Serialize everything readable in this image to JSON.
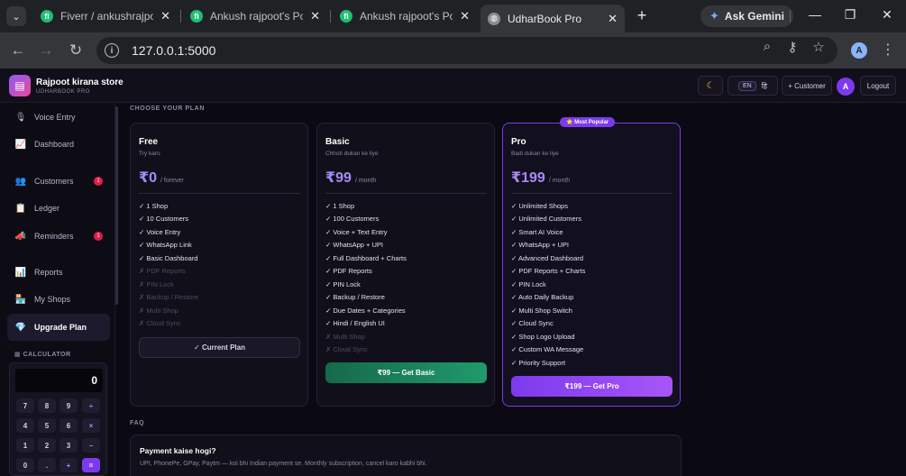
{
  "browser": {
    "tabs": [
      {
        "title": "Fiverr / ankushrajpoo29",
        "favicon": "fiverr-icon"
      },
      {
        "title": "Ankush rajpoot's Portfolio",
        "favicon": "fiverr-icon"
      },
      {
        "title": "Ankush rajpoot's Portfolio",
        "favicon": "fiverr-icon"
      },
      {
        "title": "UdharBook Pro",
        "favicon": "globe-icon"
      }
    ],
    "gemini_label": "Ask Gemini",
    "url": "127.0.0.1:5000",
    "profile_initial": "A"
  },
  "app": {
    "store_name": "Rajpoot kirana store",
    "brand": "UDHARBOOK PRO",
    "header": {
      "lang_en": "EN",
      "lang_hi": "हि",
      "add_customer": "+ Customer",
      "avatar": "A",
      "logout": "Logout"
    }
  },
  "sidebar": {
    "items": [
      {
        "label": "Voice Entry",
        "icon": "mic-icon"
      },
      {
        "label": "Dashboard",
        "icon": "chart-icon"
      },
      {
        "label": "Customers",
        "icon": "users-icon",
        "badge": "1"
      },
      {
        "label": "Ledger",
        "icon": "clipboard-icon"
      },
      {
        "label": "Reminders",
        "icon": "bell-icon",
        "badge": "1"
      },
      {
        "label": "Reports",
        "icon": "bar-chart-icon"
      },
      {
        "label": "My Shops",
        "icon": "store-icon"
      },
      {
        "label": "Upgrade Plan",
        "icon": "gem-icon"
      }
    ],
    "calculator": {
      "title": "CALCULATOR",
      "display": "0",
      "keys": [
        [
          "7",
          "8",
          "9",
          "÷"
        ],
        [
          "4",
          "5",
          "6",
          "×"
        ],
        [
          "1",
          "2",
          "3",
          "−"
        ],
        [
          "0",
          ".",
          "+",
          "="
        ]
      ]
    }
  },
  "plans": {
    "section_title": "CHOOSE YOUR PLAN",
    "popular_badge": "⭐ Most Popular",
    "cards": [
      {
        "name": "Free",
        "subtitle": "Try karo",
        "price": "₹0",
        "period": "/ forever",
        "features": [
          "✓ 1 Shop",
          "✓ 10 Customers",
          "✓ Voice Entry",
          "✓ WhatsApp Link",
          "✓ Basic Dashboard"
        ],
        "disabled": [
          "✗ PDF Reports",
          "✗ PIN Lock",
          "✗ Backup / Restore",
          "✗ Multi Shop",
          "✗ Cloud Sync"
        ],
        "button": "✓ Current Plan"
      },
      {
        "name": "Basic",
        "subtitle": "Chhoti dukan ke liye",
        "price": "₹99",
        "period": "/ month",
        "features": [
          "✓ 1 Shop",
          "✓ 100 Customers",
          "✓ Voice + Text Entry",
          "✓ WhatsApp + UPI",
          "✓ Full Dashboard + Charts",
          "✓ PDF Reports",
          "✓ PIN Lock",
          "✓ Backup / Restore",
          "✓ Due Dates + Categories",
          "✓ Hindi / English UI"
        ],
        "disabled": [
          "✗ Multi Shop",
          "✗ Cloud Sync"
        ],
        "button": "₹99 — Get Basic"
      },
      {
        "name": "Pro",
        "subtitle": "Badi dukan ke liye",
        "price": "₹199",
        "period": "/ month",
        "features": [
          "✓ Unlimited Shops",
          "✓ Unlimited Customers",
          "✓ Smart AI Voice",
          "✓ WhatsApp + UPI",
          "✓ Advanced Dashboard",
          "✓ PDF Reports + Charts",
          "✓ PIN Lock",
          "✓ Auto Daily Backup",
          "✓ Multi Shop Switch",
          "✓ Cloud Sync",
          "✓ Shop Logo Upload",
          "✓ Custom WA Message",
          "✓ Priority Support"
        ],
        "disabled": [],
        "button": "₹199 — Get Pro"
      }
    ]
  },
  "faq": {
    "title": "FAQ",
    "items": [
      {
        "q": "Payment kaise hogi?",
        "a": "UPI, PhonePe, GPay, Paytm — koi bhi Indian payment se. Monthly subscription, cancel karo kabhi bhi."
      }
    ]
  },
  "colors": {
    "accent": "#7c3aed",
    "basic_button": "#1f9a6b",
    "badge": "#e11d48"
  }
}
